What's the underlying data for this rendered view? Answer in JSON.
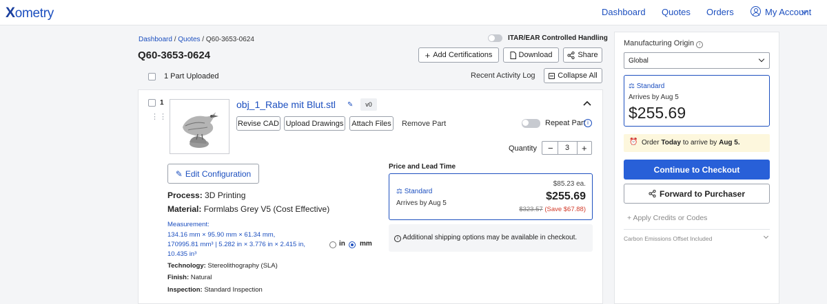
{
  "nav": {
    "logo": "ometry",
    "logo_x": "X",
    "links": [
      "Dashboard",
      "Quotes",
      "Orders"
    ],
    "account": "My Account"
  },
  "breadcrumb": {
    "dashboard": "Dashboard",
    "quotes": "Quotes",
    "current": "Q60-3653-0624",
    "sep": " / "
  },
  "quote": {
    "id": "Q60-3653-0624",
    "itar_label": "ITAR/EAR Controlled Handling",
    "add_certifications": "Add Certifications",
    "download": "Download",
    "share": "Share",
    "parts_uploaded": "1 Part Uploaded",
    "recent_activity": "Recent Activity Log",
    "collapse_all": "Collapse All"
  },
  "part": {
    "index": "1",
    "name": "obj_1_Rabe mit Blut.stl",
    "version": "v0",
    "revise_cad": "Revise CAD",
    "upload_drawings": "Upload Drawings",
    "attach_files": "Attach Files",
    "remove_part": "Remove Part",
    "repeat_part": "Repeat Part",
    "quantity_label": "Quantity",
    "quantity": "3",
    "edit_configuration": "Edit Configuration",
    "process_label": "Process:",
    "process": "3D Printing",
    "material_label": "Material:",
    "material": "Formlabs Grey V5 (Cost Effective)",
    "measurement_label": "Measurement:",
    "measurement_line1": "134.16 mm × 95.90 mm × 61.34 mm,",
    "measurement_line2": "170995.81 mm³  |  5.282 in × 3.776 in × 2.415 in,",
    "measurement_line3": "10.435 in³",
    "unit_in": "in",
    "unit_mm": "mm",
    "technology_label": "Technology:",
    "technology": "Stereolithography (SLA)",
    "finish_label": "Finish:",
    "finish": "Natural",
    "inspection_label": "Inspection:",
    "inspection": "Standard Inspection"
  },
  "pricing": {
    "section_title": "Price and Lead Time",
    "tier": "Standard",
    "arrives": "Arrives by Aug 5",
    "unit_price": "$85.23 ea.",
    "total": "$255.69",
    "original": "$323.57",
    "savings": "(Save $67.88)",
    "shipping_note": "Additional shipping options may be available in checkout."
  },
  "sidebar": {
    "origin_label": "Manufacturing Origin",
    "origin_value": "Global",
    "tier": "Standard",
    "arrives": "Arrives by Aug 5",
    "total": "$255.69",
    "order_pre": "Order",
    "order_today": "Today",
    "order_mid": "to arrive by",
    "order_date": "Aug 5.",
    "checkout": "Continue to Checkout",
    "forward": "Forward to Purchaser",
    "credits": "+ Apply Credits or Codes",
    "carbon": "Carbon Emissions Offset Included"
  },
  "colors": {
    "brand": "#1c4fbf",
    "primary_button": "#2860d8",
    "savings": "#d23b2a",
    "notice_bg": "#fdf7dd"
  }
}
